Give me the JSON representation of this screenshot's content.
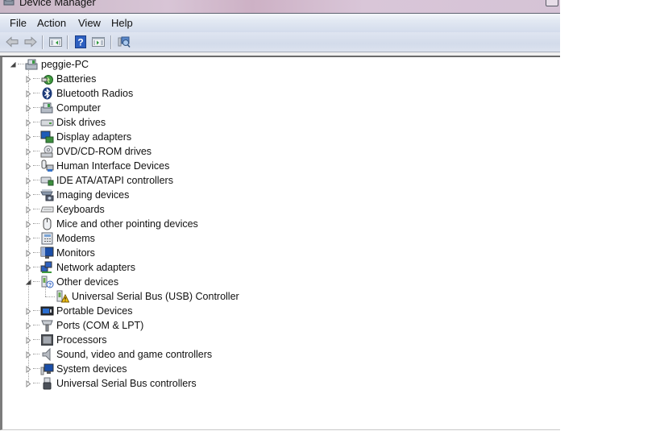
{
  "window": {
    "title": "Device Manager"
  },
  "menubar": {
    "items": [
      {
        "label": "File"
      },
      {
        "label": "Action"
      },
      {
        "label": "View"
      },
      {
        "label": "Help"
      }
    ]
  },
  "toolbar": {
    "buttons": [
      {
        "icon": "back-arrow-icon",
        "name": "back-button"
      },
      {
        "icon": "forward-arrow-icon",
        "name": "forward-button"
      },
      {
        "icon": "show-hide-console-tree-icon",
        "name": "show-hide-console-tree-button"
      },
      {
        "icon": "help-icon",
        "name": "help-button"
      },
      {
        "icon": "show-hide-action-pane-icon",
        "name": "show-hide-action-pane-button"
      },
      {
        "icon": "scan-hardware-changes-icon",
        "name": "scan-hardware-button"
      }
    ]
  },
  "tree": {
    "root": {
      "label": "peggie-PC",
      "icon": "computer-icon",
      "expanded": true
    },
    "categories": [
      {
        "label": "Batteries",
        "icon": "battery-icon",
        "expanded": false
      },
      {
        "label": "Bluetooth Radios",
        "icon": "bluetooth-icon",
        "expanded": false
      },
      {
        "label": "Computer",
        "icon": "computer-icon",
        "expanded": false
      },
      {
        "label": "Disk drives",
        "icon": "disk-drive-icon",
        "expanded": false
      },
      {
        "label": "Display adapters",
        "icon": "display-adapter-icon",
        "expanded": false
      },
      {
        "label": "DVD/CD-ROM drives",
        "icon": "dvd-drive-icon",
        "expanded": false
      },
      {
        "label": "Human Interface Devices",
        "icon": "hid-icon",
        "expanded": false
      },
      {
        "label": "IDE ATA/ATAPI controllers",
        "icon": "ide-controller-icon",
        "expanded": false
      },
      {
        "label": "Imaging devices",
        "icon": "imaging-device-icon",
        "expanded": false
      },
      {
        "label": "Keyboards",
        "icon": "keyboard-icon",
        "expanded": false
      },
      {
        "label": "Mice and other pointing devices",
        "icon": "mouse-icon",
        "expanded": false
      },
      {
        "label": "Modems",
        "icon": "modem-icon",
        "expanded": false
      },
      {
        "label": "Monitors",
        "icon": "monitor-icon",
        "expanded": false
      },
      {
        "label": "Network adapters",
        "icon": "network-adapter-icon",
        "expanded": false
      },
      {
        "label": "Other devices",
        "icon": "unknown-device-icon",
        "expanded": true,
        "children": [
          {
            "label": "Universal Serial Bus (USB) Controller",
            "icon": "warning-device-icon"
          }
        ]
      },
      {
        "label": "Portable Devices",
        "icon": "portable-device-icon",
        "expanded": false
      },
      {
        "label": "Ports (COM & LPT)",
        "icon": "port-icon",
        "expanded": false
      },
      {
        "label": "Processors",
        "icon": "processor-icon",
        "expanded": false
      },
      {
        "label": "Sound, video and game controllers",
        "icon": "speaker-icon",
        "expanded": false
      },
      {
        "label": "System devices",
        "icon": "system-device-icon",
        "expanded": false
      },
      {
        "label": "Universal Serial Bus controllers",
        "icon": "usb-icon",
        "expanded": false
      }
    ]
  }
}
